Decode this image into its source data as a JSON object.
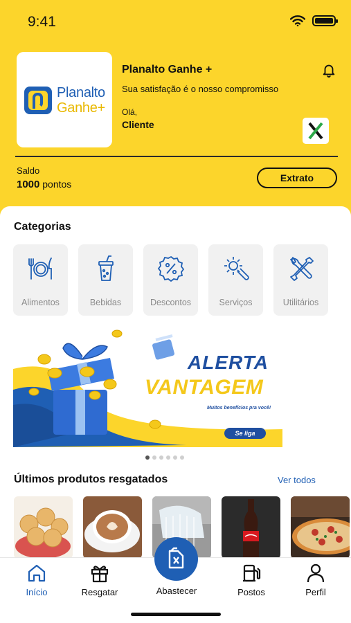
{
  "status_bar": {
    "time": "9:41",
    "icons": [
      "wifi-icon",
      "battery-icon"
    ]
  },
  "header": {
    "logo": {
      "line1": "Planalto",
      "line2": "Ganhe+"
    },
    "title": "Planalto Ganhe +",
    "subtitle": "Sua satisfação é o nosso compromisso",
    "greeting": "Olá,",
    "user_name": "Cliente",
    "notification_icon": "bell-icon",
    "partner_badge": "X"
  },
  "balance": {
    "label": "Saldo",
    "value": "1000",
    "unit": "pontos",
    "statement_button": "Extrato"
  },
  "categories": {
    "title": "Categorias",
    "items": [
      {
        "label": "Alimentos",
        "icon": "cutlery-plate-icon"
      },
      {
        "label": "Bebidas",
        "icon": "drink-cup-icon"
      },
      {
        "label": "Descontos",
        "icon": "discount-badge-icon"
      },
      {
        "label": "Serviços",
        "icon": "wrench-gear-icon"
      },
      {
        "label": "Utilitários",
        "icon": "tools-icon"
      }
    ]
  },
  "banner": {
    "headline1": "ALERTA",
    "headline2": "VANTAGEM",
    "subtitle": "Muitos benefícios pra você!",
    "cta": "Se liga",
    "slides_total": 6,
    "active_slide": 1
  },
  "recent": {
    "title": "Últimos produtos resgatados",
    "see_all": "Ver todos",
    "products": [
      "pao-de-queijo",
      "cappuccino",
      "car-wash",
      "coca-cola",
      "pizza"
    ]
  },
  "nav": {
    "items": [
      {
        "label": "Início",
        "icon": "home-icon",
        "active": true
      },
      {
        "label": "Resgatar",
        "icon": "gift-icon",
        "active": false
      },
      {
        "label": "Abastecer",
        "icon": "fuel-can-icon",
        "active": false
      },
      {
        "label": "Postos",
        "icon": "fuel-pump-icon",
        "active": false
      },
      {
        "label": "Perfil",
        "icon": "user-icon",
        "active": false
      }
    ]
  },
  "colors": {
    "brand_yellow": "#FCD52B",
    "brand_blue": "#1F5FB4"
  }
}
